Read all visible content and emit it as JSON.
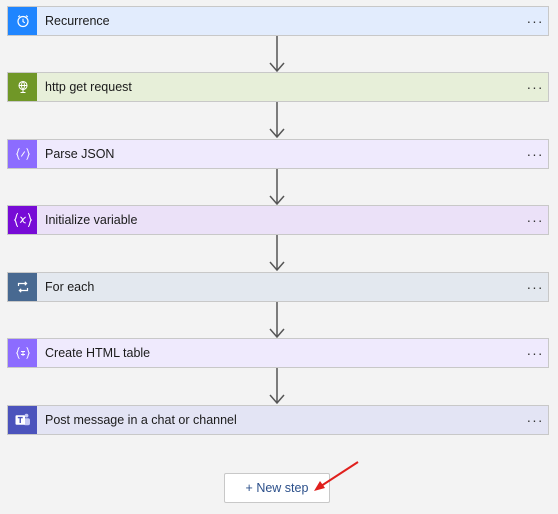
{
  "steps": [
    {
      "label": "Recurrence",
      "icon": "alarm-clock-icon",
      "icon_bg": "#1f85ff",
      "row_bg": "#e2ecfd"
    },
    {
      "label": "http get request",
      "icon": "globe-icon",
      "icon_bg": "#709727",
      "row_bg": "#e7efd9"
    },
    {
      "label": "Parse JSON",
      "icon": "braces-icon",
      "icon_bg": "#8c6cff",
      "row_bg": "#efeafd"
    },
    {
      "label": "Initialize variable",
      "icon": "variable-icon",
      "icon_bg": "#770bd6",
      "row_bg": "#ebe1f8"
    },
    {
      "label": "For each",
      "icon": "loop-icon",
      "icon_bg": "#486991",
      "row_bg": "#e3e8ef"
    },
    {
      "label": "Create HTML table",
      "icon": "braces-icon",
      "icon_bg": "#8c6cff",
      "row_bg": "#efeafd"
    },
    {
      "label": "Post message in a chat or channel",
      "icon": "teams-icon",
      "icon_bg": "#4b53bc",
      "row_bg": "#e3e4f4"
    }
  ],
  "more_label": "···",
  "new_step_label": "+ New step",
  "colors": {
    "connector": "#555555",
    "annotation_arrow": "#e0201d",
    "new_step_text": "#2b4f8a"
  }
}
